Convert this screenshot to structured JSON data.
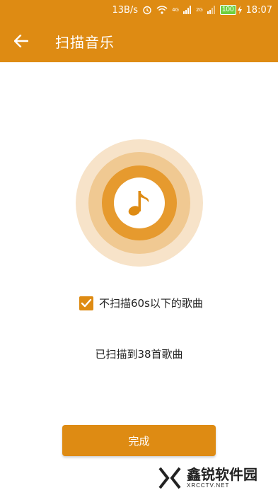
{
  "status_bar": {
    "speed": "13B/s",
    "network_1": "4G",
    "network_2": "2G",
    "battery": "100",
    "time": "18:07"
  },
  "header": {
    "title": "扫描音乐"
  },
  "options": {
    "skip_short_label": "不扫描60s以下的歌曲",
    "skip_short_checked": true
  },
  "scan": {
    "result_text": "已扫描到38首歌曲"
  },
  "actions": {
    "done_label": "完成"
  },
  "watermark": {
    "main": "鑫锐软件园",
    "sub": "XRCCTV.NET"
  },
  "colors": {
    "accent": "#de8b13",
    "ring_outer": "#f7e3c9",
    "ring_mid": "#f0c992",
    "ring_inner": "#e69a2e"
  },
  "icons": {
    "back": "arrow-left-icon",
    "music": "music-note-icon",
    "check": "checkmark-icon"
  }
}
